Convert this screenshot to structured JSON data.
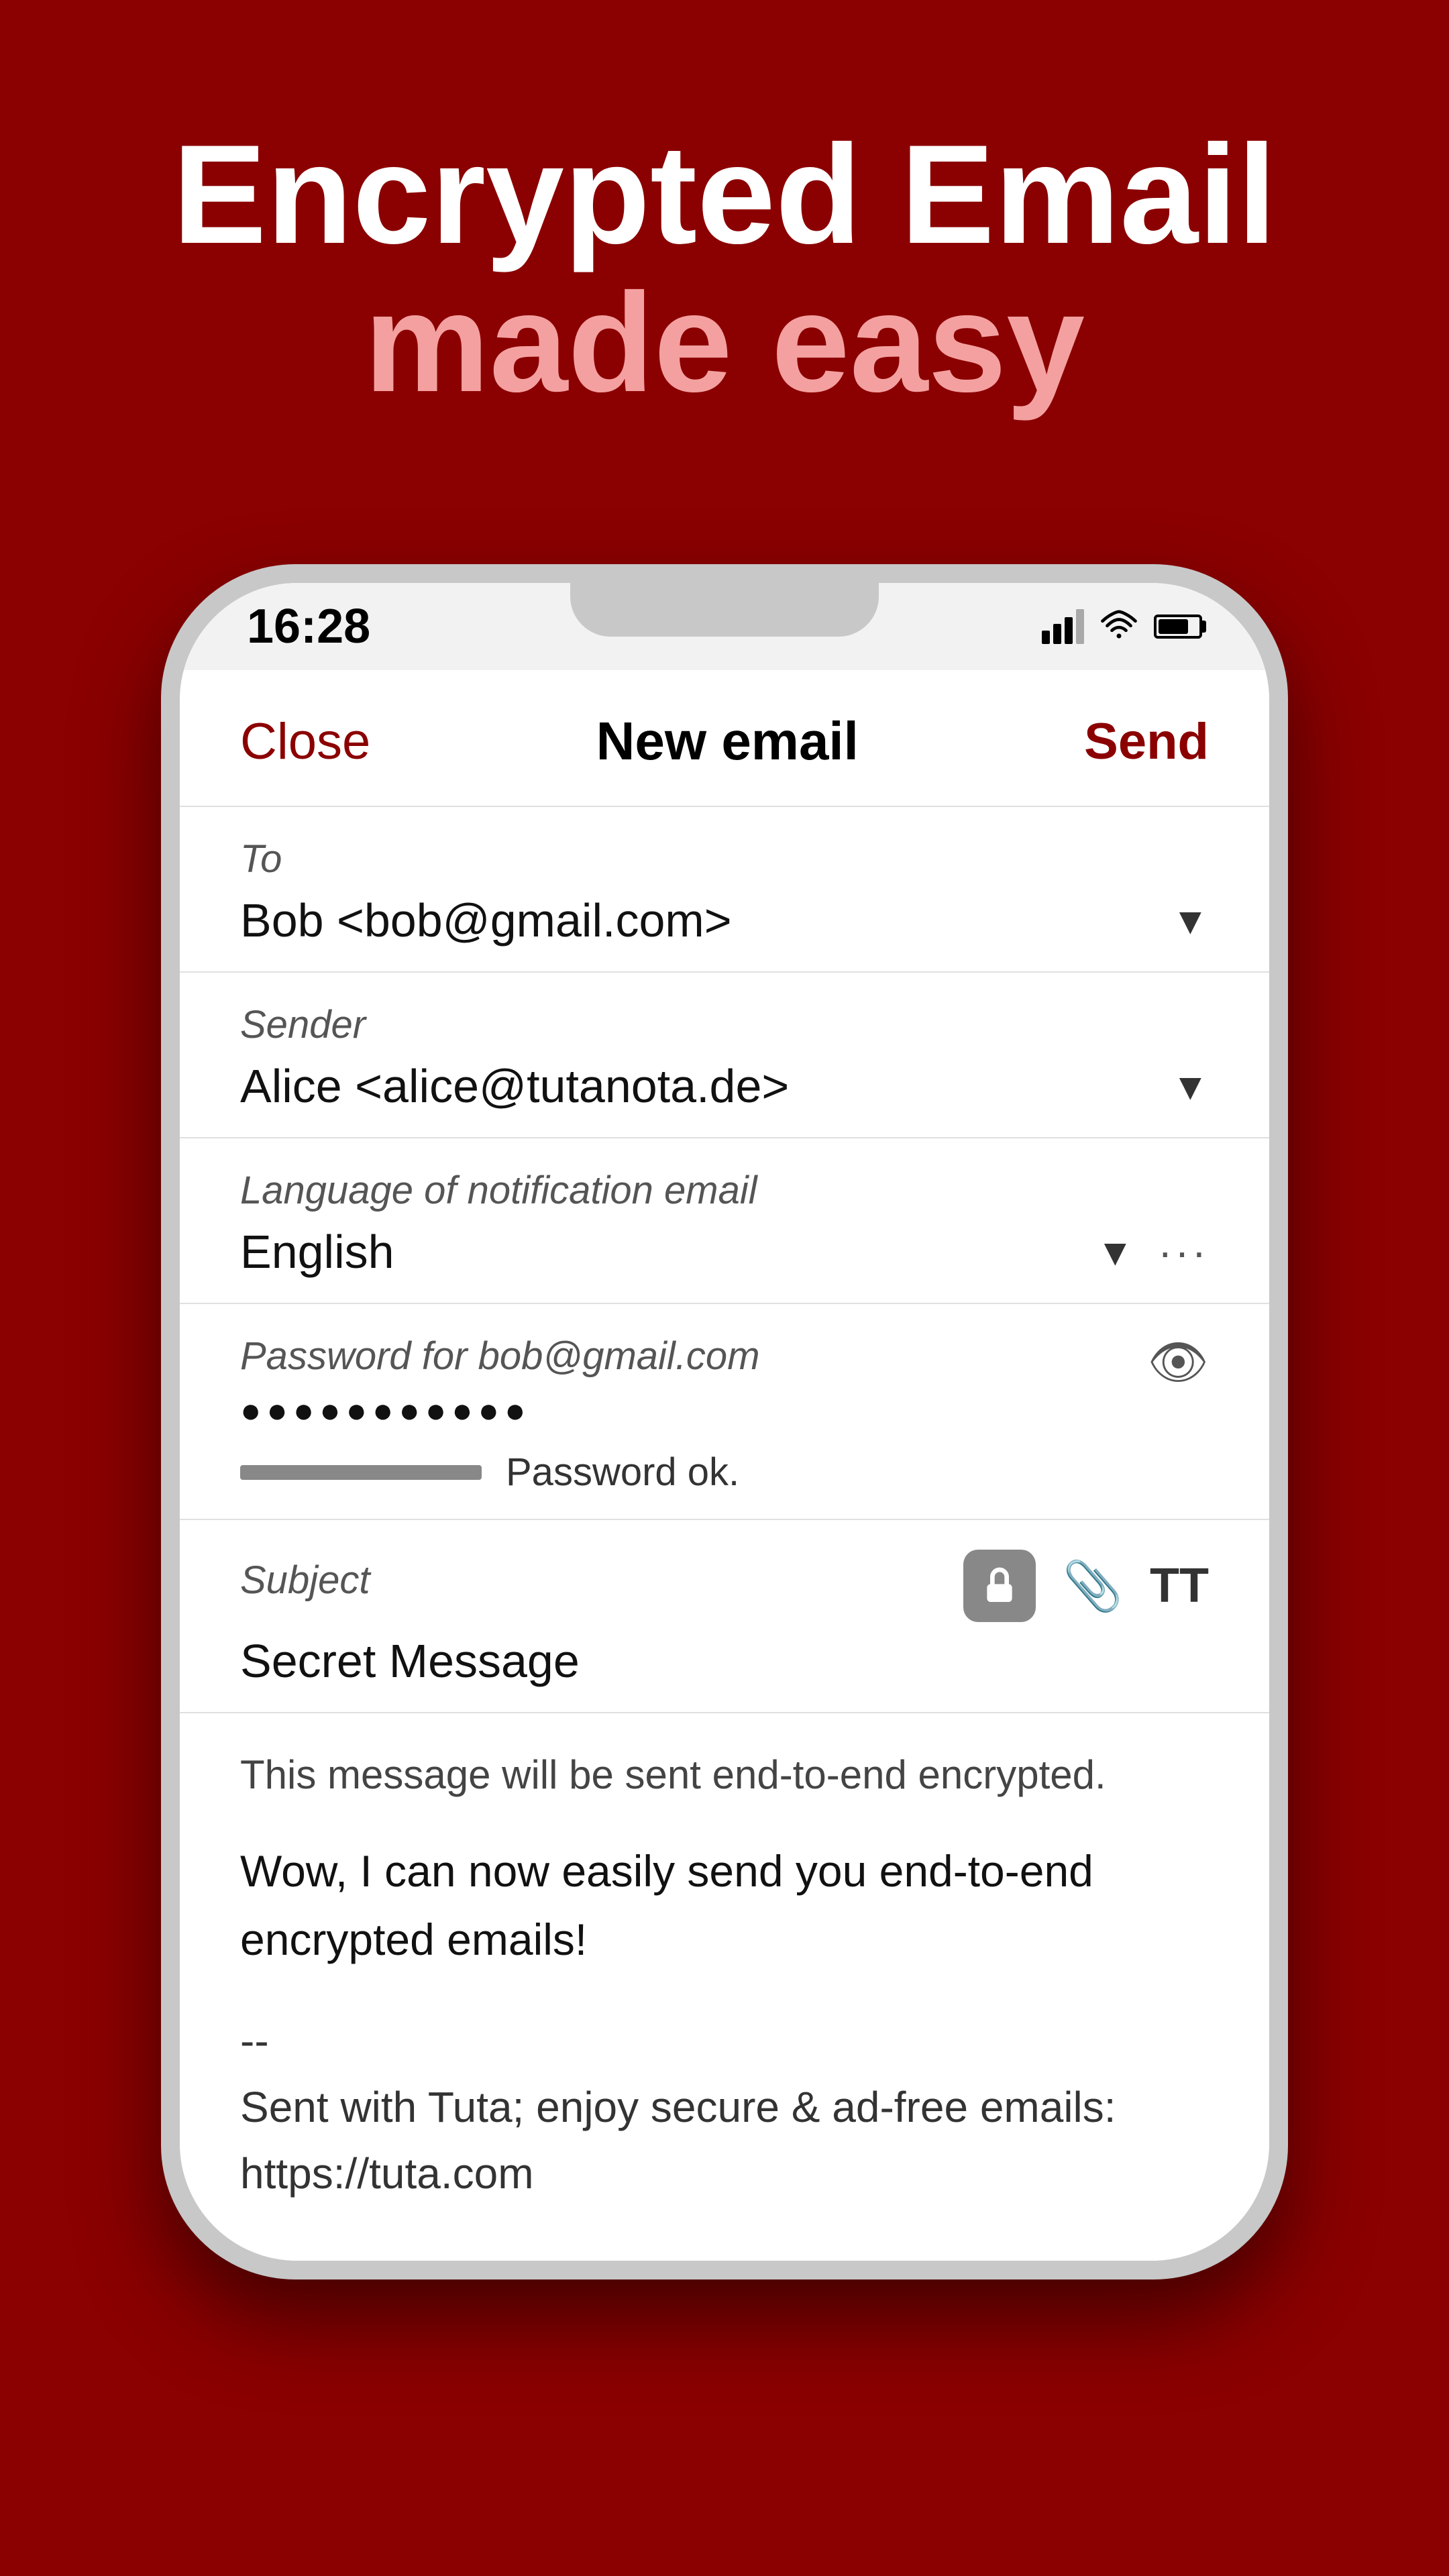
{
  "hero": {
    "line1": "Encrypted Email",
    "line2": "made easy"
  },
  "status_bar": {
    "time": "16:28"
  },
  "compose": {
    "close_label": "Close",
    "title": "New email",
    "send_label": "Send",
    "to_label": "To",
    "to_value": "Bob <bob@gmail.com>",
    "sender_label": "Sender",
    "sender_value": "Alice <alice@tutanota.de>",
    "language_label": "Language of notification email",
    "language_value": "English",
    "password_label": "Password for bob@gmail.com",
    "password_dots": "●●●●●●●●●●●",
    "password_status": "Password ok.",
    "subject_label": "Subject",
    "subject_value": "Secret Message",
    "encryption_notice": "This message will be sent end-to-end encrypted.",
    "body_text": "Wow, I can now easily send you end-to-end encrypted emails!",
    "signature_line1": "--",
    "signature_line2": "Sent with Tuta; enjoy secure & ad-free emails:",
    "signature_line3": "https://tuta.com"
  }
}
